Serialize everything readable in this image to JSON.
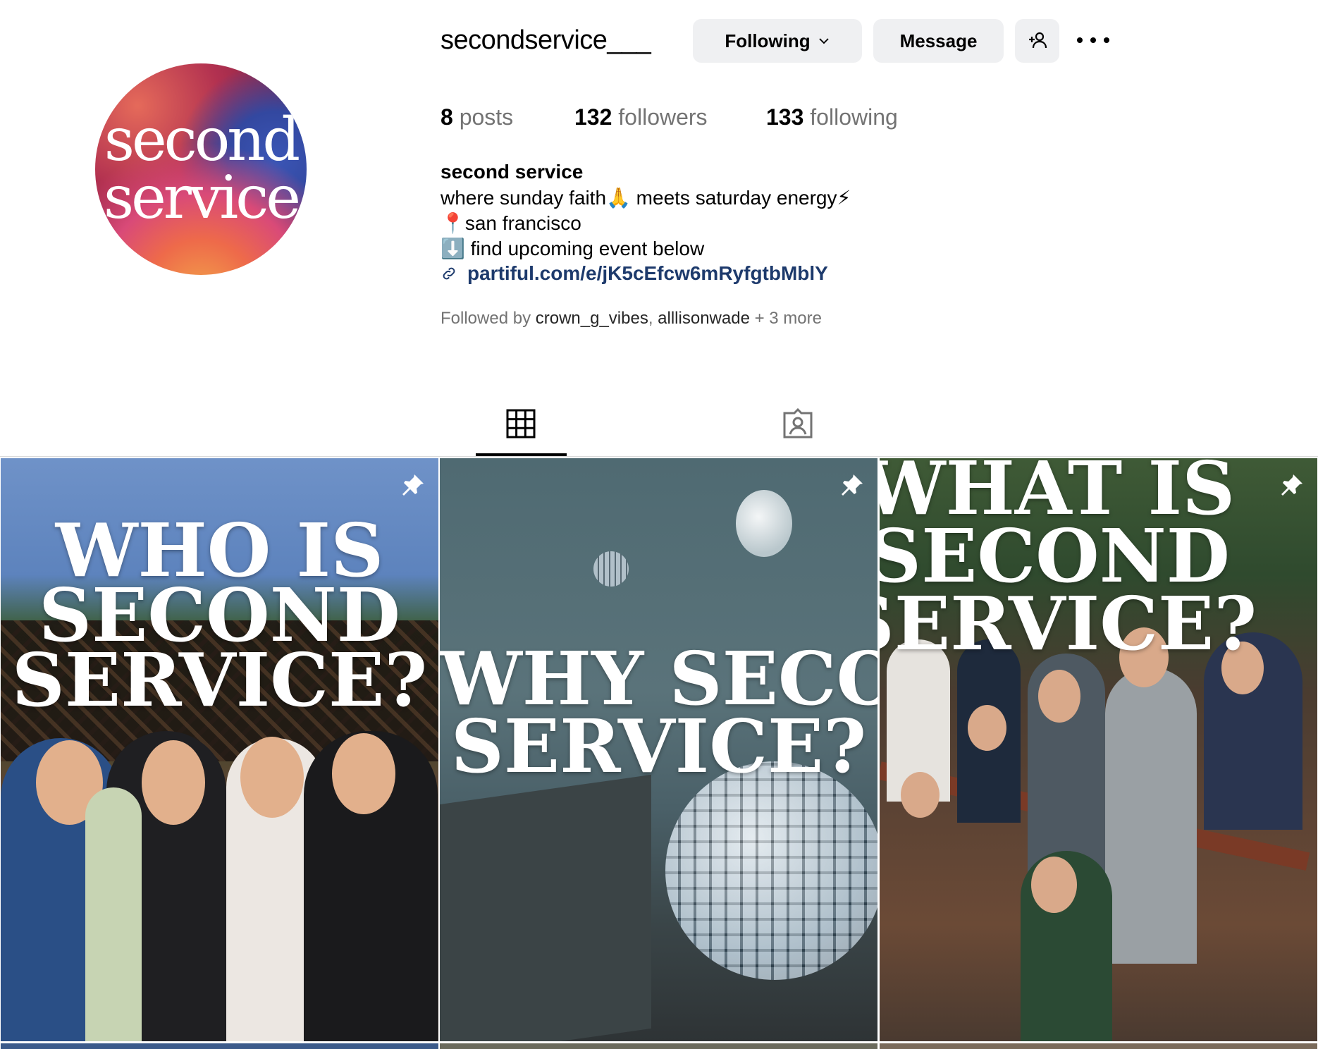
{
  "profile": {
    "username": "secondservice___",
    "avatar_text_line1": "second",
    "avatar_text_line2": "service",
    "following_label": "Following",
    "message_label": "Message",
    "stats": {
      "posts_count": "8",
      "posts_label": "posts",
      "followers_count": "132",
      "followers_label": "followers",
      "following_count": "133",
      "following_label": "following"
    },
    "bio": {
      "name": "second service",
      "line1": "where sunday faith🙏 meets saturday energy⚡",
      "line2": "📍san francisco",
      "line3": "⬇️ find upcoming event below",
      "link": "partiful.com/e/jK5cEfcw6mRyfgtbMblY"
    },
    "followed_by": {
      "prefix": "Followed by",
      "user1": "crown_g_vibes",
      "separator": ",",
      "user2": "alllisonwade",
      "suffix": "+ 3 more"
    }
  },
  "tabs": [
    {
      "icon": "grid-icon",
      "active": true
    },
    {
      "icon": "tagged-icon",
      "active": false
    }
  ],
  "posts": [
    {
      "title_line1": "WHO IS",
      "title_line2": "SECOND",
      "title_line3": "SERVICE?",
      "pinned": true
    },
    {
      "title_line1": "WHY SECOND",
      "title_line2": "SERVICE?",
      "pinned": true
    },
    {
      "title_line1": "WHAT IS",
      "title_line2": "SECOND",
      "title_line3": "SERVICE?",
      "pinned": true
    }
  ],
  "colors": {
    "button_bg": "#eff0f2",
    "link": "#1d3a6c",
    "muted_text": "#737373"
  }
}
